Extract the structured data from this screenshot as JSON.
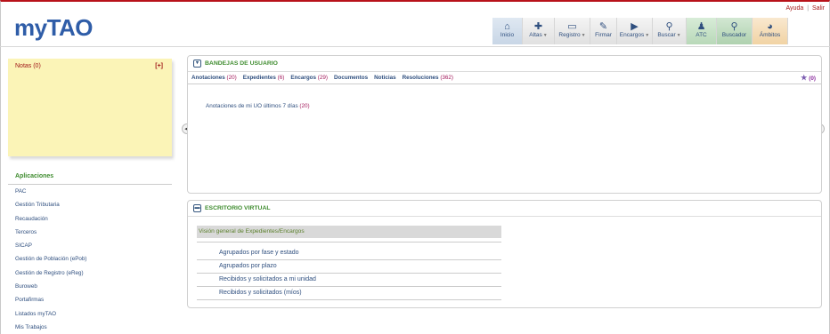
{
  "app": {
    "logo": "myTAO"
  },
  "toplinks": {
    "help": "Ayuda",
    "sep": "|",
    "exit": "Salir"
  },
  "toolbar": [
    {
      "label": "Inicio",
      "icon": "house-icon",
      "glyph": "⌂",
      "caret": false,
      "style": "active",
      "width": 34
    },
    {
      "label": "Altas",
      "icon": "plus-icon",
      "glyph": "✚",
      "caret": true,
      "style": "",
      "width": 36
    },
    {
      "label": "Registro",
      "icon": "book-icon",
      "glyph": "▭",
      "caret": true,
      "style": "",
      "width": 40
    },
    {
      "label": "Firmar",
      "icon": "pen-icon",
      "glyph": "✎",
      "caret": false,
      "style": "",
      "width": 30
    },
    {
      "label": "Encargos",
      "icon": "truck-icon",
      "glyph": "▶",
      "caret": true,
      "style": "",
      "width": 40
    },
    {
      "label": "Buscar",
      "icon": "search-icon",
      "glyph": "⚲",
      "caret": true,
      "style": "",
      "width": 38
    },
    {
      "label": "ATC",
      "icon": "person-icon",
      "glyph": "♟",
      "caret": false,
      "style": "green",
      "width": 34
    },
    {
      "label": "Buscador",
      "icon": "search-icon",
      "glyph": "⚲",
      "caret": false,
      "style": "green2",
      "width": 40
    },
    {
      "label": "Ámbitos",
      "icon": "pie-chart-icon",
      "glyph": "◕",
      "caret": false,
      "style": "orange",
      "width": 40
    }
  ],
  "notes": {
    "title": "Notas (0)",
    "add": "[+]"
  },
  "apps": {
    "title": "Aplicaciones",
    "items": [
      "PAC",
      "Gestión Tributaria",
      "Recaudación",
      "Terceros",
      "SICAP",
      "Gestión de Población (ePob)",
      "Gestión de Registro (eReg)",
      "Buroweb",
      "Portafirmas",
      "Listados myTAO",
      "Mis Trabajos"
    ]
  },
  "bandejas": {
    "title": "BANDEJAS DE USUARIO",
    "tabs": [
      {
        "label": "Anotaciones",
        "count": "(20)"
      },
      {
        "label": "Expedientes",
        "count": "(6)"
      },
      {
        "label": "Encargos",
        "count": "(29)"
      },
      {
        "label": "Documentos",
        "count": ""
      },
      {
        "label": "Noticias",
        "count": ""
      },
      {
        "label": "Resoluciones",
        "count": "(362)"
      }
    ],
    "starred": "(0)",
    "anotaciones_text": "Anotaciones de mi UO últimos 7 días",
    "anotaciones_count": "(20)"
  },
  "escritorio": {
    "title": "ESCRITORIO VIRTUAL",
    "section": "Visión general de Expedientes/Encargos",
    "links": [
      "Agrupados por fase y estado",
      "Agrupados por plazo",
      "Recibidos y solicitados a mi unidad",
      "Recibidos y solicitados (míos)"
    ]
  }
}
